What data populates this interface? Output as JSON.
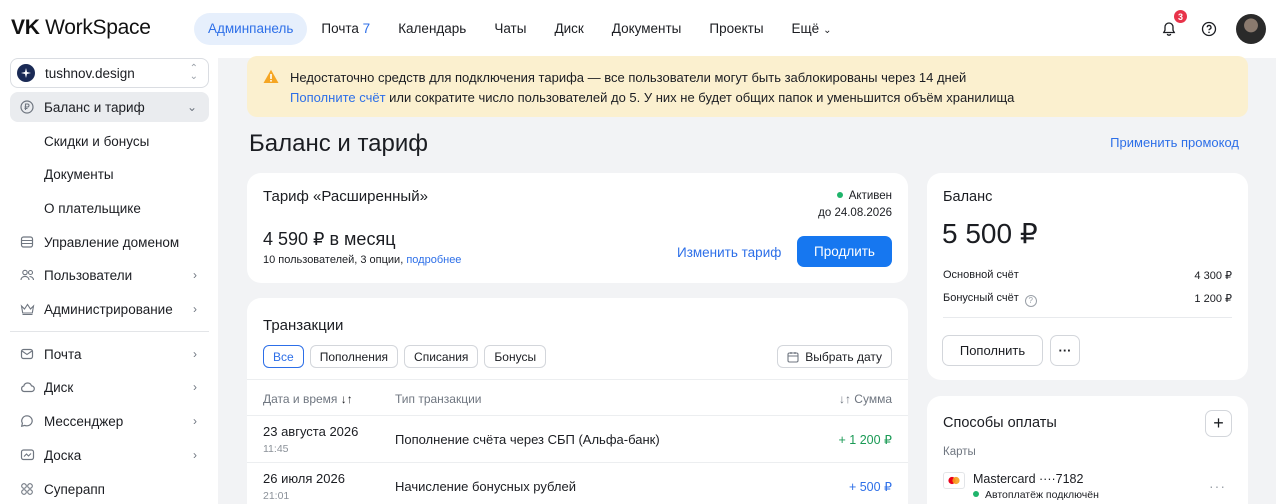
{
  "app": {
    "logo_bold": "VK",
    "logo_rest": " WorkSpace"
  },
  "nav": {
    "items": [
      {
        "label": "Админпанель",
        "active": true
      },
      {
        "label": "Почта",
        "count": "7"
      },
      {
        "label": "Календарь"
      },
      {
        "label": "Чаты"
      },
      {
        "label": "Диск"
      },
      {
        "label": "Документы"
      },
      {
        "label": "Проекты"
      },
      {
        "label": "Ещё"
      }
    ],
    "notifications": "3"
  },
  "sidebar": {
    "org": "tushnov.design",
    "items": [
      {
        "label": "Баланс и тариф",
        "icon": "ruble-icon"
      },
      {
        "label": "Скидки и бонусы"
      },
      {
        "label": "Документы"
      },
      {
        "label": "О плательщике"
      },
      {
        "label": "Управление доменом",
        "icon": "domain-icon"
      },
      {
        "label": "Пользователи",
        "icon": "users-icon"
      },
      {
        "label": "Администрирование",
        "icon": "crown-icon"
      },
      {
        "label": "Почта",
        "icon": "mail-icon"
      },
      {
        "label": "Диск",
        "icon": "cloud-icon"
      },
      {
        "label": "Мессенджер",
        "icon": "chat-icon"
      },
      {
        "label": "Доска",
        "icon": "board-icon"
      },
      {
        "label": "Суперапп",
        "icon": "apps-icon"
      }
    ]
  },
  "alert": {
    "line1": "Недостаточно средств для подключения тарифа — все пользователи могут быть заблокированы через 14 дней",
    "link": "Пополните счёт",
    "line2_rest": " или сократите число пользователей до 5. У них не будет общих папок и уменьшится объём хранилища"
  },
  "page": {
    "title": "Баланс и тариф",
    "promo": "Применить промокод"
  },
  "tariff": {
    "title": "Тариф «Расширенный»",
    "status": "Активен",
    "until": "до 24.08.2026",
    "price": "4 590 ₽ в месяц",
    "meta": "10 пользователей, 3 опции, ",
    "meta_link": "подробнее",
    "change": "Изменить тариф",
    "extend": "Продлить"
  },
  "transactions": {
    "title": "Транзакции",
    "filters": [
      "Все",
      "Пополнения",
      "Списания",
      "Бонусы"
    ],
    "date_button": "Выбрать дату",
    "columns": {
      "date": "Дата и время",
      "type": "Тип транзакции",
      "sum": "Сумма"
    },
    "rows": [
      {
        "date": "23 августа 2026",
        "time": "11:45",
        "type": "Пополнение счёта через СБП (Альфа-банк)",
        "sum": "+ 1 200 ₽",
        "color": "#1a9a55"
      },
      {
        "date": "26 июля 2026",
        "time": "21:01",
        "type": "Начисление бонусных рублей",
        "sum": "+ 500 ₽",
        "color": "#2d6fe8"
      }
    ]
  },
  "balance": {
    "title": "Баланс",
    "amount": "5 500 ₽",
    "main_label": "Основной счёт",
    "main_value": "4 300 ₽",
    "bonus_label": "Бонусный счёт",
    "bonus_value": "1 200 ₽",
    "topup": "Пополнить"
  },
  "payments": {
    "title": "Способы оплаты",
    "cards_label": "Карты",
    "card_name": "Mastercard ····7182",
    "card_status": "Автоплатёж подключён"
  }
}
